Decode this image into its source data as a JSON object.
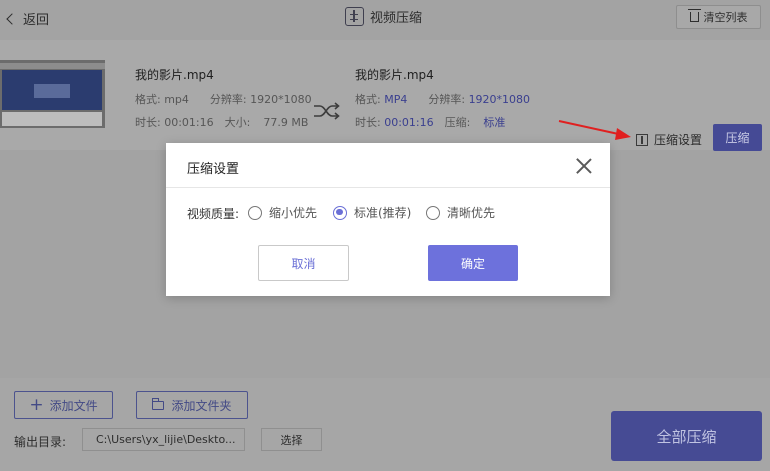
{
  "header": {
    "back_label": "返回",
    "title": "视频压缩",
    "clear_label": "清空列表"
  },
  "file": {
    "source": {
      "name": "我的影片.mp4",
      "format_label": "格式:",
      "format": "mp4",
      "resolution_label": "分辨率:",
      "resolution": "1920*1080",
      "duration_label": "时长:",
      "duration": "00:01:16",
      "size_label": "大小:",
      "size": "77.9 MB"
    },
    "target": {
      "name": "我的影片.mp4",
      "format_label": "格式:",
      "format": "MP4",
      "resolution_label": "分辨率:",
      "resolution": "1920*1080",
      "duration_label": "时长:",
      "duration": "00:01:16",
      "compress_label": "压缩:",
      "compress": "标准"
    },
    "settings_label": "压缩设置",
    "compress_label": "压缩"
  },
  "bottom": {
    "add_file_label": "添加文件",
    "add_folder_label": "添加文件夹",
    "output_label": "输出目录:",
    "output_path": "C:\\Users\\yx_lijie\\Deskto...",
    "choose_label": "选择",
    "compress_all_label": "全部压缩"
  },
  "modal": {
    "title": "压缩设置",
    "quality_label": "视频质量:",
    "options": [
      {
        "label": "缩小优先",
        "selected": false
      },
      {
        "label": "标准(推荐)",
        "selected": true
      },
      {
        "label": "清晰优先",
        "selected": false
      }
    ],
    "cancel_label": "取消",
    "ok_label": "确定"
  },
  "colors": {
    "accent": "#6d71dc",
    "overlay_gray": "#a3a3a3",
    "dim_accent": "#464b94",
    "pointer_red": "#e02020"
  }
}
